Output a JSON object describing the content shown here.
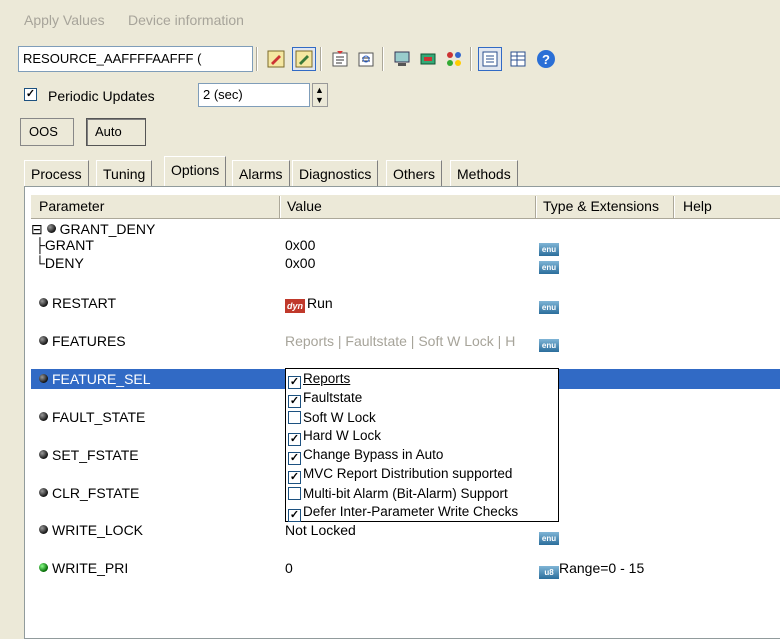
{
  "menu": {
    "items": [
      "Apply Values",
      "Device information"
    ]
  },
  "toolbar": {
    "resource_value": "RESOURCE_AAFFFFAAFFF ("
  },
  "periodic": {
    "label": "Periodic Updates",
    "checked": true,
    "interval": "2 (sec)"
  },
  "modes": {
    "oos": "OOS",
    "auto": "Auto"
  },
  "tabs": [
    "Process",
    "Tuning",
    "Options",
    "Alarms",
    "Diagnostics",
    "Others",
    "Methods"
  ],
  "active_tab": "Options",
  "columns": {
    "parameter": "Parameter",
    "value": "Value",
    "type": "Type & Extensions",
    "help": "Help"
  },
  "rows": {
    "grant_deny": {
      "name": "GRANT_DENY",
      "expander": "⊟"
    },
    "grant": {
      "name": "GRANT",
      "value": "0x00",
      "type": "enu"
    },
    "deny": {
      "name": "DENY",
      "value": "0x00",
      "type": "enu"
    },
    "restart": {
      "name": "RESTART",
      "value": "Run",
      "badge": "dyn",
      "type": "enu"
    },
    "features": {
      "name": "FEATURES",
      "value": "Reports | Faultstate | Soft W Lock | H",
      "type": "enu"
    },
    "feature_sel": {
      "name": "FEATURE_SEL"
    },
    "fault_state": {
      "name": "FAULT_STATE"
    },
    "set_fstate": {
      "name": "SET_FSTATE"
    },
    "clr_fstate": {
      "name": "CLR_FSTATE"
    },
    "write_lock": {
      "name": "WRITE_LOCK",
      "value": "Not Locked",
      "type": "enu"
    },
    "write_pri": {
      "name": "WRITE_PRI",
      "value": "0",
      "type": "u8",
      "extension": "Range=0 - 15"
    }
  },
  "feature_options": [
    {
      "label": "Reports",
      "checked": true
    },
    {
      "label": "Faultstate",
      "checked": true
    },
    {
      "label": "Soft W Lock",
      "checked": false
    },
    {
      "label": "Hard W Lock",
      "checked": true
    },
    {
      "label": "Change Bypass in Auto",
      "checked": true
    },
    {
      "label": "MVC Report Distribution supported",
      "checked": true
    },
    {
      "label": "Multi-bit Alarm (Bit-Alarm) Support",
      "checked": false
    },
    {
      "label": "Defer Inter-Parameter Write Checks",
      "checked": true
    }
  ],
  "colors": {
    "selection": "#316ac5",
    "window": "#ece9d8"
  }
}
